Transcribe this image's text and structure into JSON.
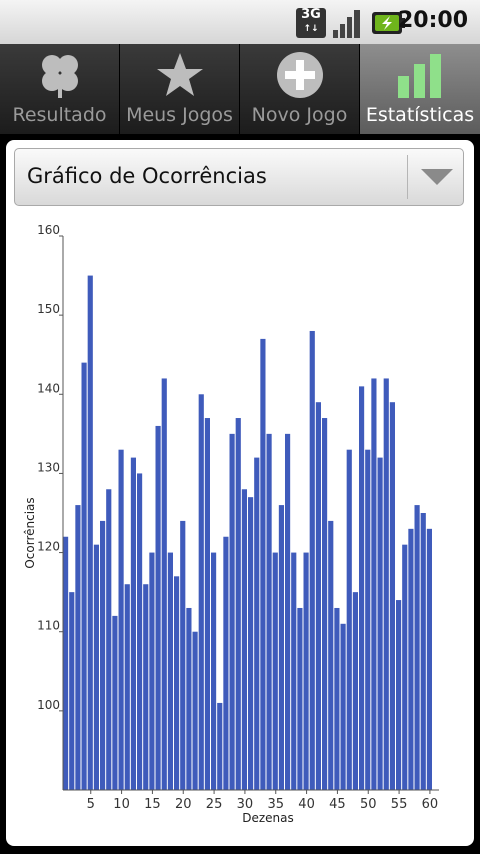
{
  "status_bar": {
    "network": "3G",
    "time": "20:00",
    "icons": [
      "network-3g-icon",
      "signal-icon",
      "battery-icon"
    ]
  },
  "tabs": [
    {
      "label": "Resultado",
      "icon": "clover-icon",
      "active": false
    },
    {
      "label": "Meus Jogos",
      "icon": "star-icon",
      "active": false
    },
    {
      "label": "Novo Jogo",
      "icon": "plus-icon",
      "active": false
    },
    {
      "label": "Estatísticas",
      "icon": "bar-chart-icon",
      "active": true
    }
  ],
  "spinner": {
    "selected": "Gráfico de Ocorrências",
    "icon": "chevron-down-icon"
  },
  "colors": {
    "bar": "#3f5bbb",
    "tab_active": "#7a7a7a",
    "tab_inactive": "#2a2a2a"
  },
  "chart_data": {
    "type": "bar",
    "xlabel": "Dezenas",
    "ylabel": "Ocorrências",
    "ylim": [
      90,
      160
    ],
    "yticks": [
      100,
      110,
      120,
      130,
      140,
      150,
      160
    ],
    "xticks": [
      5,
      10,
      15,
      20,
      25,
      30,
      35,
      40,
      45,
      50,
      55,
      60
    ],
    "categories": [
      1,
      2,
      3,
      4,
      5,
      6,
      7,
      8,
      9,
      10,
      11,
      12,
      13,
      14,
      15,
      16,
      17,
      18,
      19,
      20,
      21,
      22,
      23,
      24,
      25,
      26,
      27,
      28,
      29,
      30,
      31,
      32,
      33,
      34,
      35,
      36,
      37,
      38,
      39,
      40,
      41,
      42,
      43,
      44,
      45,
      46,
      47,
      48,
      49,
      50,
      51,
      52,
      53,
      54,
      55,
      56,
      57,
      58,
      59,
      60
    ],
    "values": [
      122,
      115,
      126,
      144,
      155,
      121,
      124,
      128,
      112,
      133,
      116,
      132,
      130,
      116,
      120,
      136,
      142,
      120,
      117,
      124,
      113,
      110,
      140,
      137,
      120,
      101,
      122,
      135,
      137,
      128,
      127,
      132,
      147,
      135,
      120,
      126,
      135,
      120,
      113,
      120,
      148,
      139,
      137,
      124,
      113,
      111,
      133,
      115,
      141,
      133,
      142,
      132,
      142,
      139,
      114,
      121,
      123,
      126,
      125,
      123
    ]
  }
}
